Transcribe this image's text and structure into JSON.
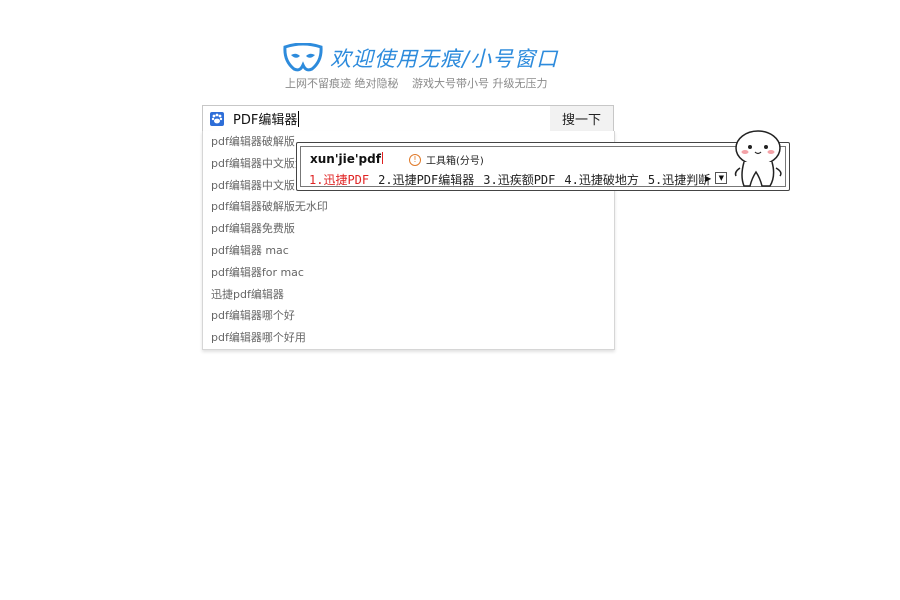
{
  "brand": {
    "title": "欢迎使用无痕/小号窗口",
    "subtitle_parts": [
      "上网不留痕迹 绝对隐秘",
      "游戏大号带小号 升级无压力"
    ],
    "color": "#2d8bdc"
  },
  "search": {
    "value": "PDF编辑器",
    "button_label": "搜一下",
    "icon": "paw-icon"
  },
  "suggestions": [
    "pdf编辑器破解版",
    "pdf编辑器中文版免",
    "pdf编辑器中文版",
    "pdf编辑器破解版无水印",
    "pdf编辑器免费版",
    "pdf编辑器 mac",
    "pdf编辑器for mac",
    "迅捷pdf编辑器",
    "pdf编辑器哪个好",
    "pdf编辑器哪个好用"
  ],
  "ime": {
    "pinyin": "xun'jie'pdf",
    "toolbox": "工具箱(分号)",
    "candidates": [
      "1.迅捷PDF",
      "2.迅捷PDF编辑器",
      "3.迅疾额PDF",
      "4.迅捷破地方",
      "5.迅捷判断"
    ],
    "nav_prev": "◀",
    "nav_next": "▶",
    "nav_more": "▼",
    "active_color": "#e02424"
  }
}
